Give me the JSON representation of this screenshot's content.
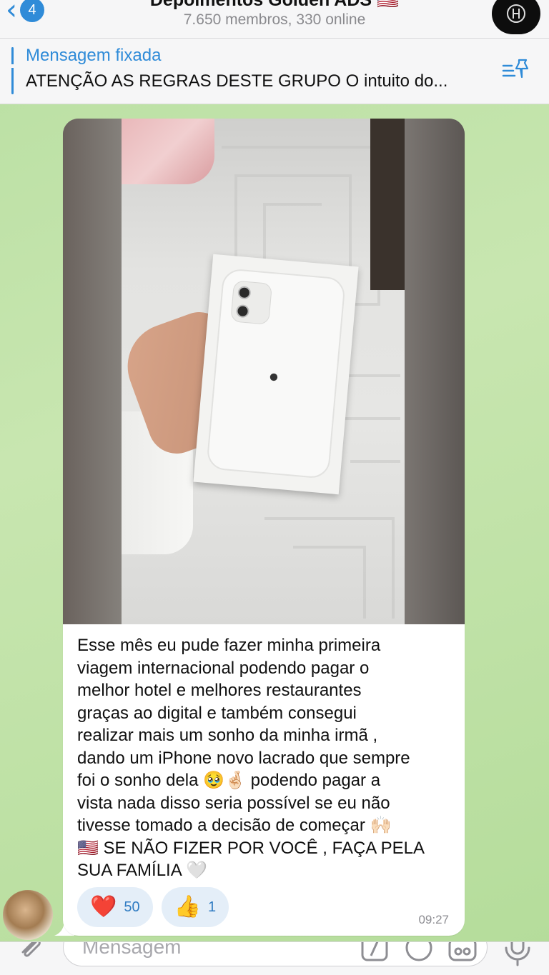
{
  "header": {
    "back_count": "4",
    "title": "Depoimentos Golden ADS 🇺🇸",
    "subtitle": "7.650 membros, 330 online"
  },
  "pinned": {
    "label": "Mensagem fixada",
    "text": "ATENÇÃO AS REGRAS DESTE GRUPO O intuito do..."
  },
  "message": {
    "lines": [
      "Esse mês eu pude fazer minha primeira",
      "viagem internacional podendo pagar o",
      "melhor hotel e melhores restaurantes",
      "graças ao digital e também consegui",
      "realizar mais um sonho da minha irmã ,",
      "dando um iPhone novo lacrado que sempre",
      "foi o sonho dela 🥹🤞🏻 podendo pagar a",
      "vista nada disso seria possível se eu não",
      "tivesse tomado a decisão de começar 🙌🏻",
      "🇺🇸 SE NÃO FIZER POR VOCÊ , FAÇA PELA",
      "SUA FAMÍLIA 🤍"
    ],
    "reactions": [
      {
        "emoji": "❤️",
        "count": "50"
      },
      {
        "emoji": "👍",
        "count": "1"
      }
    ],
    "time": "09:27"
  },
  "input": {
    "placeholder": "Mensagem"
  },
  "colors": {
    "accent": "#2f8bd8",
    "reaction_bg": "#e4eef8",
    "chat_bg": "#c8e6b0"
  }
}
